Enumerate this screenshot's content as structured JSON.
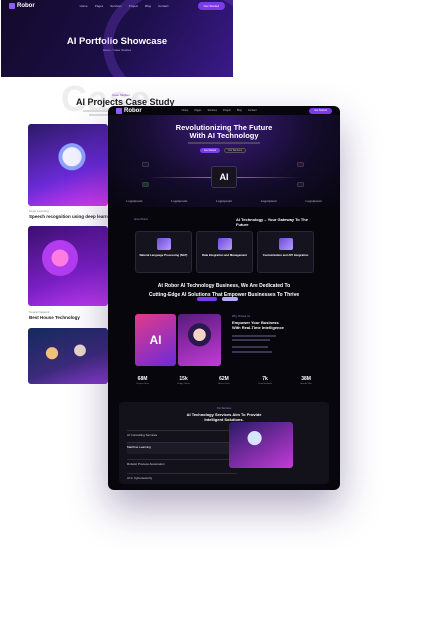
{
  "back_page": {
    "brand": "Robor",
    "nav": [
      "Home",
      "Pages",
      "Services",
      "Project",
      "Blog",
      "Contact"
    ],
    "nav_button": "Get Started",
    "hero_title": "AI Portfolio Showcase",
    "breadcrumb": "Home  /  Case Studies",
    "watermark": "Case",
    "eyebrow": "Case Studies",
    "section_title": "AI Projects Case Study",
    "projects": [
      {
        "tag": "Deep Learning",
        "title": "Speech recognition using deep learning"
      },
      {
        "tag": "Neural Network",
        "title": "Best House Technology"
      }
    ]
  },
  "front_page": {
    "brand": "Robor",
    "nav": [
      "Home",
      "Pages",
      "Services",
      "Project",
      "Blog",
      "Contact"
    ],
    "nav_button": "Get Started",
    "hero_title_line1": "Revolutionizing The Future",
    "hero_title_line2": "With AI Technology",
    "hero_button_primary": "Get Started",
    "hero_button_secondary": "Our Services",
    "chip_label": "AI",
    "partner_logos": [
      "Logoipsum",
      "Logoipsum",
      "Logoipsum",
      "Logoipsum",
      "Logoipsum"
    ],
    "about_label": "About Robor",
    "about_title": "AI Technology – Your Gateway To The Future",
    "features": [
      {
        "title": "Natural Language Processing (NLP)"
      },
      {
        "title": "Data Integration and Management"
      },
      {
        "title": "Customization and API Integration"
      }
    ],
    "mission_line1": "At Robor AI Technology Business, We Are Dedicated To",
    "mission_line2": "Cutting-Edge AI Solutions That Empower Businesses To Thrive",
    "ai_card_label": "AI",
    "empower_label": "Why Choose Us",
    "empower_title_line1": "Empower Your Business",
    "empower_title_line2": "With Real-Time Intelligence",
    "stats": [
      {
        "value": "68M",
        "label": "Projects Done"
      },
      {
        "value": "15k",
        "label": "Happy Clients"
      },
      {
        "value": "62M",
        "label": "Active Users"
      },
      {
        "value": "7k",
        "label": "Team Members"
      },
      {
        "value": "38M",
        "label": "Awards Won"
      }
    ],
    "services_label": "Our Services",
    "services_title_line1": "AI Technology Services Aim To Provide",
    "services_title_line2": "Intelligent Solutions.",
    "services": [
      {
        "title": "AI Consulting Services"
      },
      {
        "title": "Machine Learning"
      },
      {
        "title": "Robotic Process Automation"
      },
      {
        "title": "AI in Cybersecurity"
      }
    ]
  }
}
